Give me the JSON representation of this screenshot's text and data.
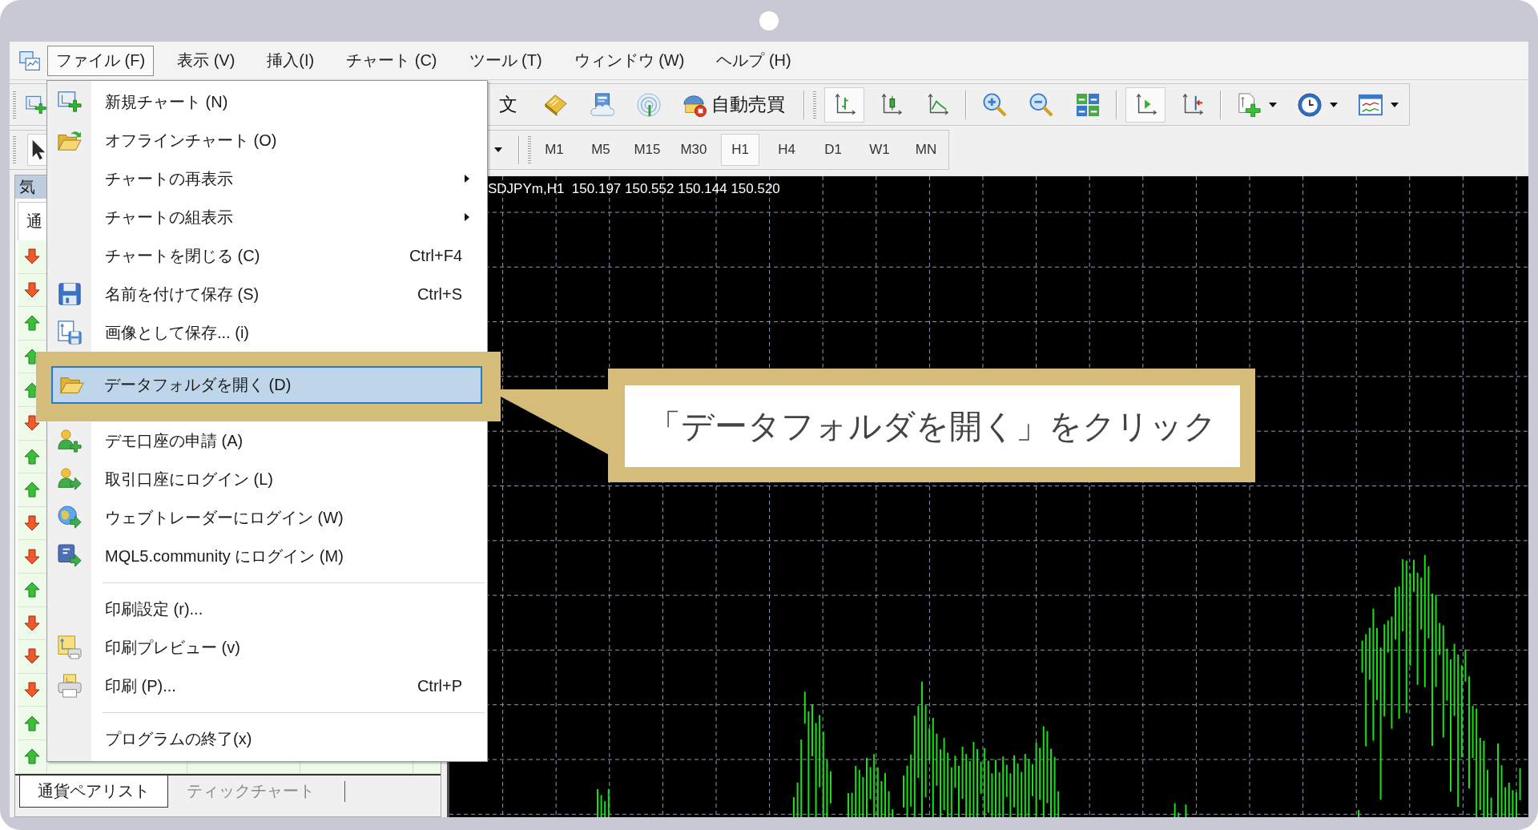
{
  "menu_bar": {
    "items": [
      {
        "label": "ファイル (F)",
        "selected": true
      },
      {
        "label": "表示 (V)",
        "selected": false
      },
      {
        "label": "挿入(I)",
        "selected": false
      },
      {
        "label": "チャート (C)",
        "selected": false
      },
      {
        "label": "ツール (T)",
        "selected": false
      },
      {
        "label": "ウィンドウ (W)",
        "selected": false
      },
      {
        "label": "ヘルプ (H)",
        "selected": false
      }
    ]
  },
  "toolbar_1": {
    "left": [
      {
        "kind": "grip"
      },
      {
        "kind": "button",
        "pressed": false,
        "dropdown": false
      }
    ],
    "right": [
      {
        "kind": "button",
        "label": "文",
        "pressed": false,
        "dropdown": false
      },
      {
        "kind": "button",
        "pressed": false,
        "dropdown": false
      },
      {
        "kind": "button",
        "pressed": false,
        "dropdown": false
      },
      {
        "kind": "button",
        "pressed": false,
        "dropdown": false
      },
      {
        "kind": "button",
        "label": "自動売買",
        "pressed": false,
        "dropdown": false
      },
      {
        "kind": "separator"
      },
      {
        "kind": "grip"
      },
      {
        "kind": "button",
        "pressed": true,
        "dropdown": false
      },
      {
        "kind": "button",
        "pressed": false,
        "dropdown": false
      },
      {
        "kind": "button",
        "pressed": false,
        "dropdown": false
      },
      {
        "kind": "separator"
      },
      {
        "kind": "button",
        "pressed": false,
        "dropdown": false
      },
      {
        "kind": "button",
        "pressed": false,
        "dropdown": false
      },
      {
        "kind": "button",
        "pressed": false,
        "dropdown": false
      },
      {
        "kind": "separator"
      },
      {
        "kind": "button",
        "pressed": true,
        "dropdown": false
      },
      {
        "kind": "button",
        "pressed": false,
        "dropdown": false
      },
      {
        "kind": "separator"
      },
      {
        "kind": "button",
        "pressed": false,
        "dropdown": true
      },
      {
        "kind": "button",
        "pressed": false,
        "dropdown": true
      },
      {
        "kind": "button",
        "pressed": false,
        "dropdown": true
      }
    ]
  },
  "toolbar_2": {
    "left": [
      {
        "kind": "grip"
      },
      {
        "kind": "button",
        "pressed": true,
        "dropdown": false
      }
    ],
    "right": [
      {
        "kind": "dropdown"
      },
      {
        "kind": "separator"
      },
      {
        "kind": "grip"
      }
    ],
    "periods": [
      {
        "label": "M1",
        "selected": false
      },
      {
        "label": "M5",
        "selected": false
      },
      {
        "label": "M15",
        "selected": false
      },
      {
        "label": "M30",
        "selected": false
      },
      {
        "label": "H1",
        "selected": true
      },
      {
        "label": "H4",
        "selected": false
      },
      {
        "label": "D1",
        "selected": false
      },
      {
        "label": "W1",
        "selected": false
      },
      {
        "label": "MN",
        "selected": false
      }
    ]
  },
  "market_watch": {
    "title": "気",
    "column": "通",
    "rows": [
      {
        "rising": false
      },
      {
        "rising": false
      },
      {
        "rising": true
      },
      {
        "rising": true
      },
      {
        "rising": true
      },
      {
        "rising": false
      },
      {
        "rising": true
      },
      {
        "rising": true
      },
      {
        "rising": false
      },
      {
        "rising": false
      },
      {
        "rising": true
      },
      {
        "rising": false
      },
      {
        "rising": false
      },
      {
        "rising": false
      },
      {
        "rising": true
      },
      {
        "rising": true
      }
    ],
    "tabs": [
      {
        "label": "通貨ペアリスト",
        "selected": true
      },
      {
        "label": "ティックチャート",
        "selected": false
      }
    ]
  },
  "chart": {
    "info": "SDJPYm,H1  150.197 150.552 150.144 150.520"
  },
  "file_menu": {
    "items": [
      {
        "kind": "item",
        "label": "新規チャート (N)",
        "submenu": false,
        "selected": false
      },
      {
        "kind": "item",
        "label": "オフラインチャート (O)",
        "submenu": false,
        "selected": false
      },
      {
        "kind": "item",
        "label": "チャートの再表示",
        "submenu": true,
        "selected": false
      },
      {
        "kind": "item",
        "label": "チャートの組表示",
        "submenu": true,
        "selected": false
      },
      {
        "kind": "item",
        "label": "チャートを閉じる (C)",
        "shortcut": "Ctrl+F4",
        "submenu": false,
        "selected": false
      },
      {
        "kind": "item",
        "label": "名前を付けて保存 (S)",
        "shortcut": "Ctrl+S",
        "submenu": false,
        "selected": false
      },
      {
        "kind": "item",
        "label": "画像として保存... (i)",
        "submenu": false,
        "selected": false
      },
      {
        "kind": "item",
        "label": "データフォルダを開く (D)",
        "submenu": false,
        "selected": true
      },
      {
        "kind": "item",
        "label": "デモ口座の申請 (A)",
        "submenu": false,
        "selected": false
      },
      {
        "kind": "item",
        "label": "取引口座にログイン (L)",
        "submenu": false,
        "selected": false
      },
      {
        "kind": "item",
        "label": "ウェブトレーダーにログイン (W)",
        "submenu": false,
        "selected": false
      },
      {
        "kind": "item",
        "label": "MQL5.community にログイン (M)",
        "submenu": false,
        "selected": false
      },
      {
        "kind": "separator"
      },
      {
        "kind": "item",
        "label": "印刷設定 (r)...",
        "submenu": false,
        "selected": false
      },
      {
        "kind": "item",
        "label": "印刷プレビュー (v)",
        "submenu": false,
        "selected": false
      },
      {
        "kind": "item",
        "label": "印刷 (P)...",
        "shortcut": "Ctrl+P",
        "submenu": false,
        "selected": false
      },
      {
        "kind": "separator"
      },
      {
        "kind": "item",
        "label": "プログラムの終了(x)",
        "submenu": false,
        "selected": false
      }
    ]
  },
  "callout": {
    "text": "「データフォルダを開く」をクリック"
  }
}
